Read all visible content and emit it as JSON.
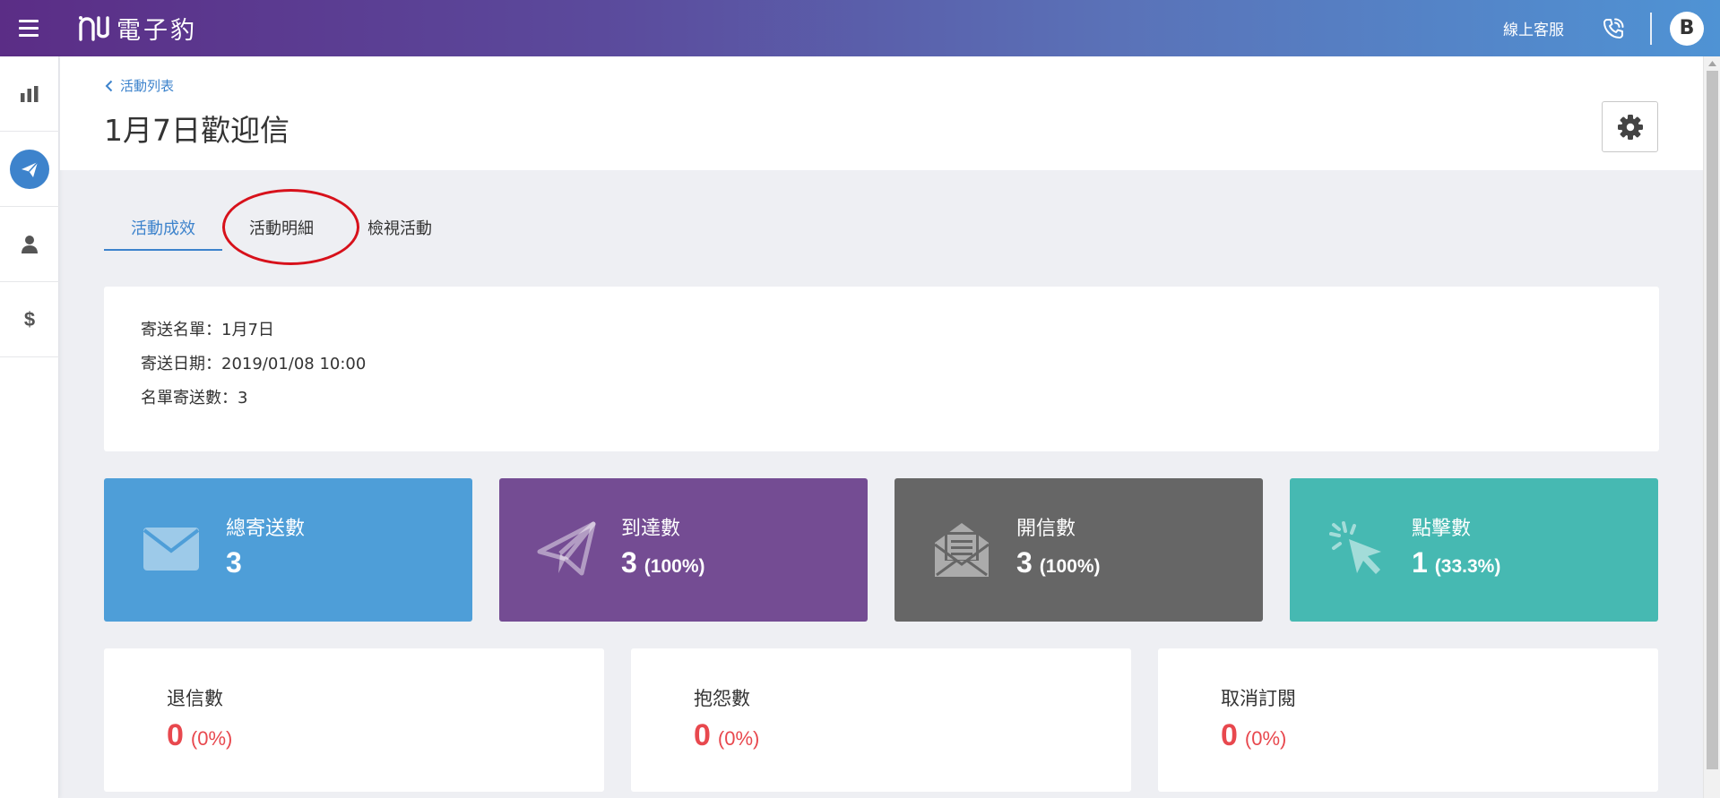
{
  "app": {
    "logo_text": "電子豹",
    "support_label": "線上客服",
    "avatar_initial": "B"
  },
  "sidebar": {
    "items": [
      {
        "name": "bar-chart-icon",
        "active": false
      },
      {
        "name": "paper-plane-icon",
        "active": true
      },
      {
        "name": "user-icon",
        "active": false
      },
      {
        "name": "dollar-icon",
        "active": false,
        "glyph": "$"
      }
    ]
  },
  "header": {
    "breadcrumb": "活動列表",
    "title": "1月7日歡迎信"
  },
  "tabs": [
    {
      "label": "活動成效",
      "active": true
    },
    {
      "label": "活動明細",
      "active": false
    },
    {
      "label": "檢視活動",
      "active": false
    }
  ],
  "info": {
    "lines": [
      "寄送名單：1月7日",
      "寄送日期：2019/01/08 10:00",
      "名單寄送數：3"
    ]
  },
  "stats": [
    {
      "label": "總寄送數",
      "value": "3",
      "pct": "",
      "color": "#4e9ed8",
      "icon": "envelope-icon"
    },
    {
      "label": "到達數",
      "value": "3",
      "pct": "(100%)",
      "color": "#744c93",
      "icon": "paper-plane-icon"
    },
    {
      "label": "開信數",
      "value": "3",
      "pct": "(100%)",
      "color": "#666666",
      "icon": "open-envelope-icon"
    },
    {
      "label": "點擊數",
      "value": "1",
      "pct": "(33.3%)",
      "color": "#46b9b2",
      "icon": "cursor-click-icon"
    }
  ],
  "negatives": [
    {
      "label": "退信數",
      "value": "0",
      "pct": "(0%)"
    },
    {
      "label": "抱怨數",
      "value": "0",
      "pct": "(0%)"
    },
    {
      "label": "取消訂閱",
      "value": "0",
      "pct": "(0%)"
    }
  ],
  "colors": {
    "accent": "#3d83cc",
    "danger": "#e8484e",
    "annotation": "#d7111b"
  }
}
